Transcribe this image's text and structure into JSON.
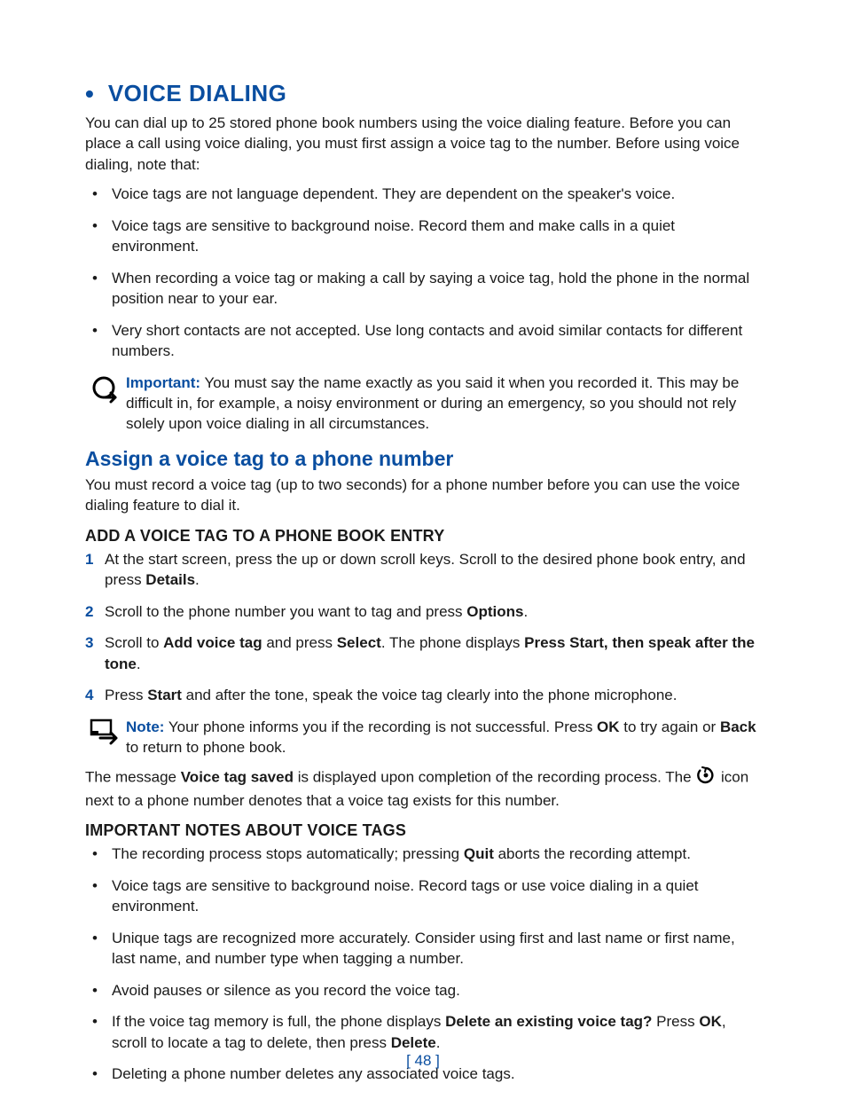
{
  "heading": "VOICE DIALING",
  "intro": "You can dial up to 25 stored phone book numbers using the voice dialing feature. Before you can place a call using voice dialing, you must first assign a voice tag to the number. Before using voice dialing, note that:",
  "intro_bullets": [
    "Voice tags are not language dependent. They are dependent on the speaker's voice.",
    "Voice tags are sensitive to background noise. Record them and make calls in a quiet environment.",
    "When recording a voice tag or making a call by saying a voice tag, hold the phone in the normal position near to your ear.",
    "Very short contacts are not accepted. Use long contacts and avoid similar contacts for different numbers."
  ],
  "important": {
    "label": "Important:",
    "text": " You must say the name exactly as you said it when you recorded it. This may be difficult in, for example, a noisy environment or during an emergency, so you should not rely solely upon voice dialing in all circumstances."
  },
  "assign_heading": "Assign a voice tag to a phone number",
  "assign_intro": "You must record a voice tag (up to two seconds) for a phone number before you can use the voice dialing feature to dial it.",
  "add_heading": "ADD A VOICE TAG TO A PHONE BOOK ENTRY",
  "steps": {
    "s1_a": "At the start screen, press the up or down scroll keys. Scroll to the desired phone book entry, and press ",
    "s1_b": "Details",
    "s1_c": ".",
    "s2_a": "Scroll to the phone number you want to tag and press ",
    "s2_b": "Options",
    "s2_c": ".",
    "s3_a": "Scroll to ",
    "s3_b": "Add voice tag",
    "s3_c": " and press ",
    "s3_d": "Select",
    "s3_e": ". The phone displays ",
    "s3_f": "Press Start, then speak after the tone",
    "s3_g": ".",
    "s4_a": "Press ",
    "s4_b": "Start",
    "s4_c": " and after the tone, speak the voice tag clearly into the phone microphone."
  },
  "note": {
    "label": "Note:",
    "a": " Your phone informs you if the recording is not successful. Press ",
    "ok": "OK",
    "b": " to try again or ",
    "back": "Back",
    "c": " to return to phone book."
  },
  "saved_para": {
    "a": "The message ",
    "b": "Voice tag saved",
    "c": " is displayed upon completion of the recording process. The ",
    "d": " icon next to a phone number denotes that a voice tag exists for this number."
  },
  "notes_heading": "IMPORTANT NOTES ABOUT VOICE TAGS",
  "notes": {
    "n1_a": "The recording process stops automatically; pressing ",
    "n1_b": "Quit",
    "n1_c": " aborts the recording attempt.",
    "n2": "Voice tags are sensitive to background noise. Record tags or use voice dialing in a quiet environment.",
    "n3": "Unique tags are recognized more accurately. Consider using first and last name or first name, last name, and number type when tagging a number.",
    "n4": "Avoid pauses or silence as you record the voice tag.",
    "n5_a": "If the voice tag memory is full, the phone displays ",
    "n5_b": "Delete an existing voice tag?",
    "n5_c": " Press ",
    "n5_d": "OK",
    "n5_e": ", scroll to locate a tag to delete, then press ",
    "n5_f": "Delete",
    "n5_g": ".",
    "n6": "Deleting a phone number deletes any associated voice tags."
  },
  "page_number": "[ 48 ]"
}
